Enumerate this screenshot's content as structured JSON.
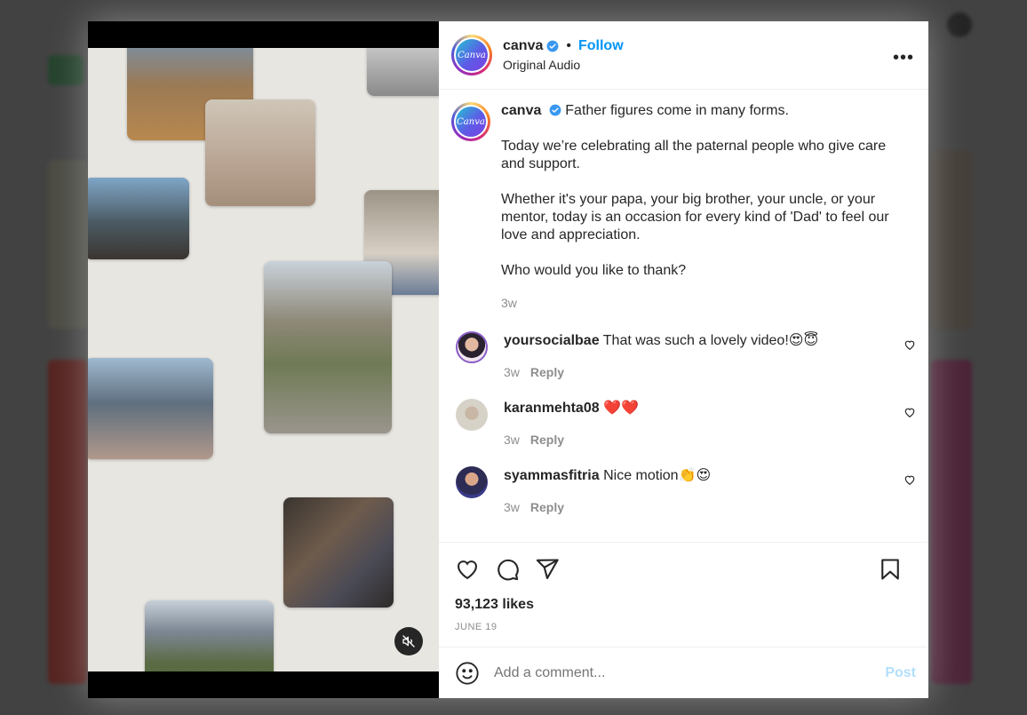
{
  "post": {
    "author": "canva",
    "avatar_text": "Canva",
    "follow_label": "Follow",
    "dot": "•",
    "audio_label": "Original Audio",
    "more_label": "•••",
    "caption_lines": [
      "Father figures come in many forms.",
      "Today we’re celebrating all the paternal people who give care and support.",
      "Whether it's your papa, your big brother, your uncle, or your mentor, today is an occasion for every kind of 'Dad' to feel our love and appreciation.",
      "Who would you like to thank?"
    ],
    "caption_age": "3w",
    "likes": "93,123 likes",
    "date": "JUNE 19"
  },
  "comments": [
    {
      "user": "yoursocialbae",
      "text": "That was such a lovely video!😍😇",
      "age": "3w",
      "reply": "Reply"
    },
    {
      "user": "karanmehta08",
      "text": "❤️❤️",
      "age": "3w",
      "reply": "Reply"
    },
    {
      "user": "syammasfitria",
      "text": "Nice motion👏😍",
      "age": "3w",
      "reply": "Reply"
    }
  ],
  "composer": {
    "placeholder": "Add a comment...",
    "post_label": "Post"
  },
  "icons": [
    "verified-icon",
    "more-icon",
    "heart-icon",
    "comment-icon",
    "share-icon",
    "bookmark-icon",
    "emoji-icon",
    "mute-icon"
  ],
  "colors": {
    "accent": "#0095f6",
    "post_disabled": "#b2dffc",
    "secondary_text": "#8e8e8e"
  }
}
